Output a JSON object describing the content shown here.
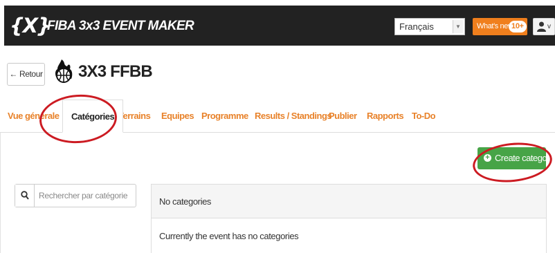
{
  "topbar": {
    "logo_text": "{X}",
    "app_title": "FIBA 3x3 EVENT MAKER",
    "language": {
      "selected": "Français"
    },
    "whats_new": {
      "label": "What's new",
      "badge": "10+"
    },
    "user_menu": {
      "icon": "user-icon",
      "chevron": "v"
    }
  },
  "header": {
    "back_label": "← Retour",
    "event_logo": "basketball-fire-logo",
    "event_title": "3X3 FFBB"
  },
  "tabs": [
    {
      "label": "Vue générale",
      "active": false
    },
    {
      "label": "Catégories",
      "active": true
    },
    {
      "label": "Terrains",
      "active": false
    },
    {
      "label": "Equipes",
      "active": false
    },
    {
      "label": "Programme",
      "active": false
    },
    {
      "label": "Results / Standings",
      "active": false
    },
    {
      "label": "Publier",
      "active": false
    },
    {
      "label": "Rapports",
      "active": false
    },
    {
      "label": "To-Do",
      "active": false
    }
  ],
  "content": {
    "create_button": {
      "label": "Create category",
      "icon": "plus-circle-icon"
    },
    "search": {
      "placeholder": "Rechercher par catégorie",
      "value": "",
      "icon": "search-icon"
    },
    "panel": {
      "title": "No categories",
      "message": "Currently the event has no categories"
    }
  },
  "colors": {
    "topbar_bg": "#222222",
    "accent_orange": "#f07f1d",
    "tab_orange": "#e8822a",
    "create_green": "#47a447",
    "annotation_red": "#cc1b22"
  }
}
